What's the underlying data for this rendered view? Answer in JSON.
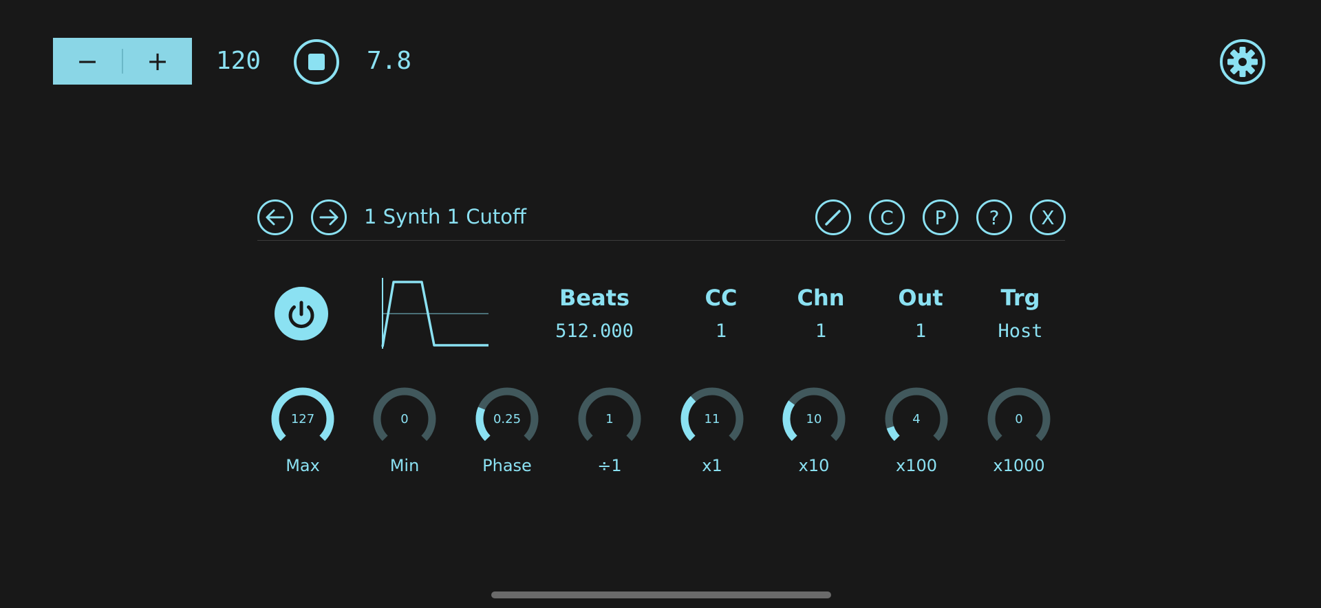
{
  "colors": {
    "accent": "#8be1f2",
    "accent_fill": "#8ad6e6",
    "track": "#41585c",
    "background": "#181818"
  },
  "transport": {
    "decrement_symbol": "−",
    "increment_symbol": "+",
    "tempo": "120",
    "stop_icon": "stop-icon",
    "position": "7.8",
    "settings_icon": "gear-icon"
  },
  "panel": {
    "title": "1 Synth 1 Cutoff",
    "nav": [
      "arrow-left-icon",
      "arrow-right-icon"
    ],
    "actions": [
      {
        "name": "edit",
        "icon": "pencil-icon",
        "glyph": ""
      },
      {
        "name": "copy",
        "icon": "c-icon",
        "glyph": "C"
      },
      {
        "name": "paste",
        "icon": "p-icon",
        "glyph": "P"
      },
      {
        "name": "help",
        "icon": "question-icon",
        "glyph": "?"
      },
      {
        "name": "close",
        "icon": "x-icon",
        "glyph": "X"
      }
    ],
    "power": {
      "icon": "power-icon",
      "on": true
    },
    "waveform": {
      "icon": "envelope-waveform",
      "shape": "trapezoid"
    },
    "params": {
      "beats": {
        "label": "Beats",
        "value": "512.000"
      },
      "cc": {
        "label": "CC",
        "value": "1"
      },
      "chn": {
        "label": "Chn",
        "value": "1"
      },
      "out": {
        "label": "Out",
        "value": "1"
      },
      "trg": {
        "label": "Trg",
        "value": "Host"
      }
    },
    "knobs": [
      {
        "value": "127",
        "label": "Max",
        "level": 1.0
      },
      {
        "value": "0",
        "label": "Min",
        "level": 0.0
      },
      {
        "value": "0.25",
        "label": "Phase",
        "level": 0.25
      },
      {
        "value": "1",
        "label": "÷1",
        "level": 0.0
      },
      {
        "value": "11",
        "label": "x1",
        "level": 0.34
      },
      {
        "value": "10",
        "label": "x10",
        "level": 0.3
      },
      {
        "value": "4",
        "label": "x100",
        "level": 0.1
      },
      {
        "value": "0",
        "label": "x1000",
        "level": 0.0
      }
    ]
  }
}
